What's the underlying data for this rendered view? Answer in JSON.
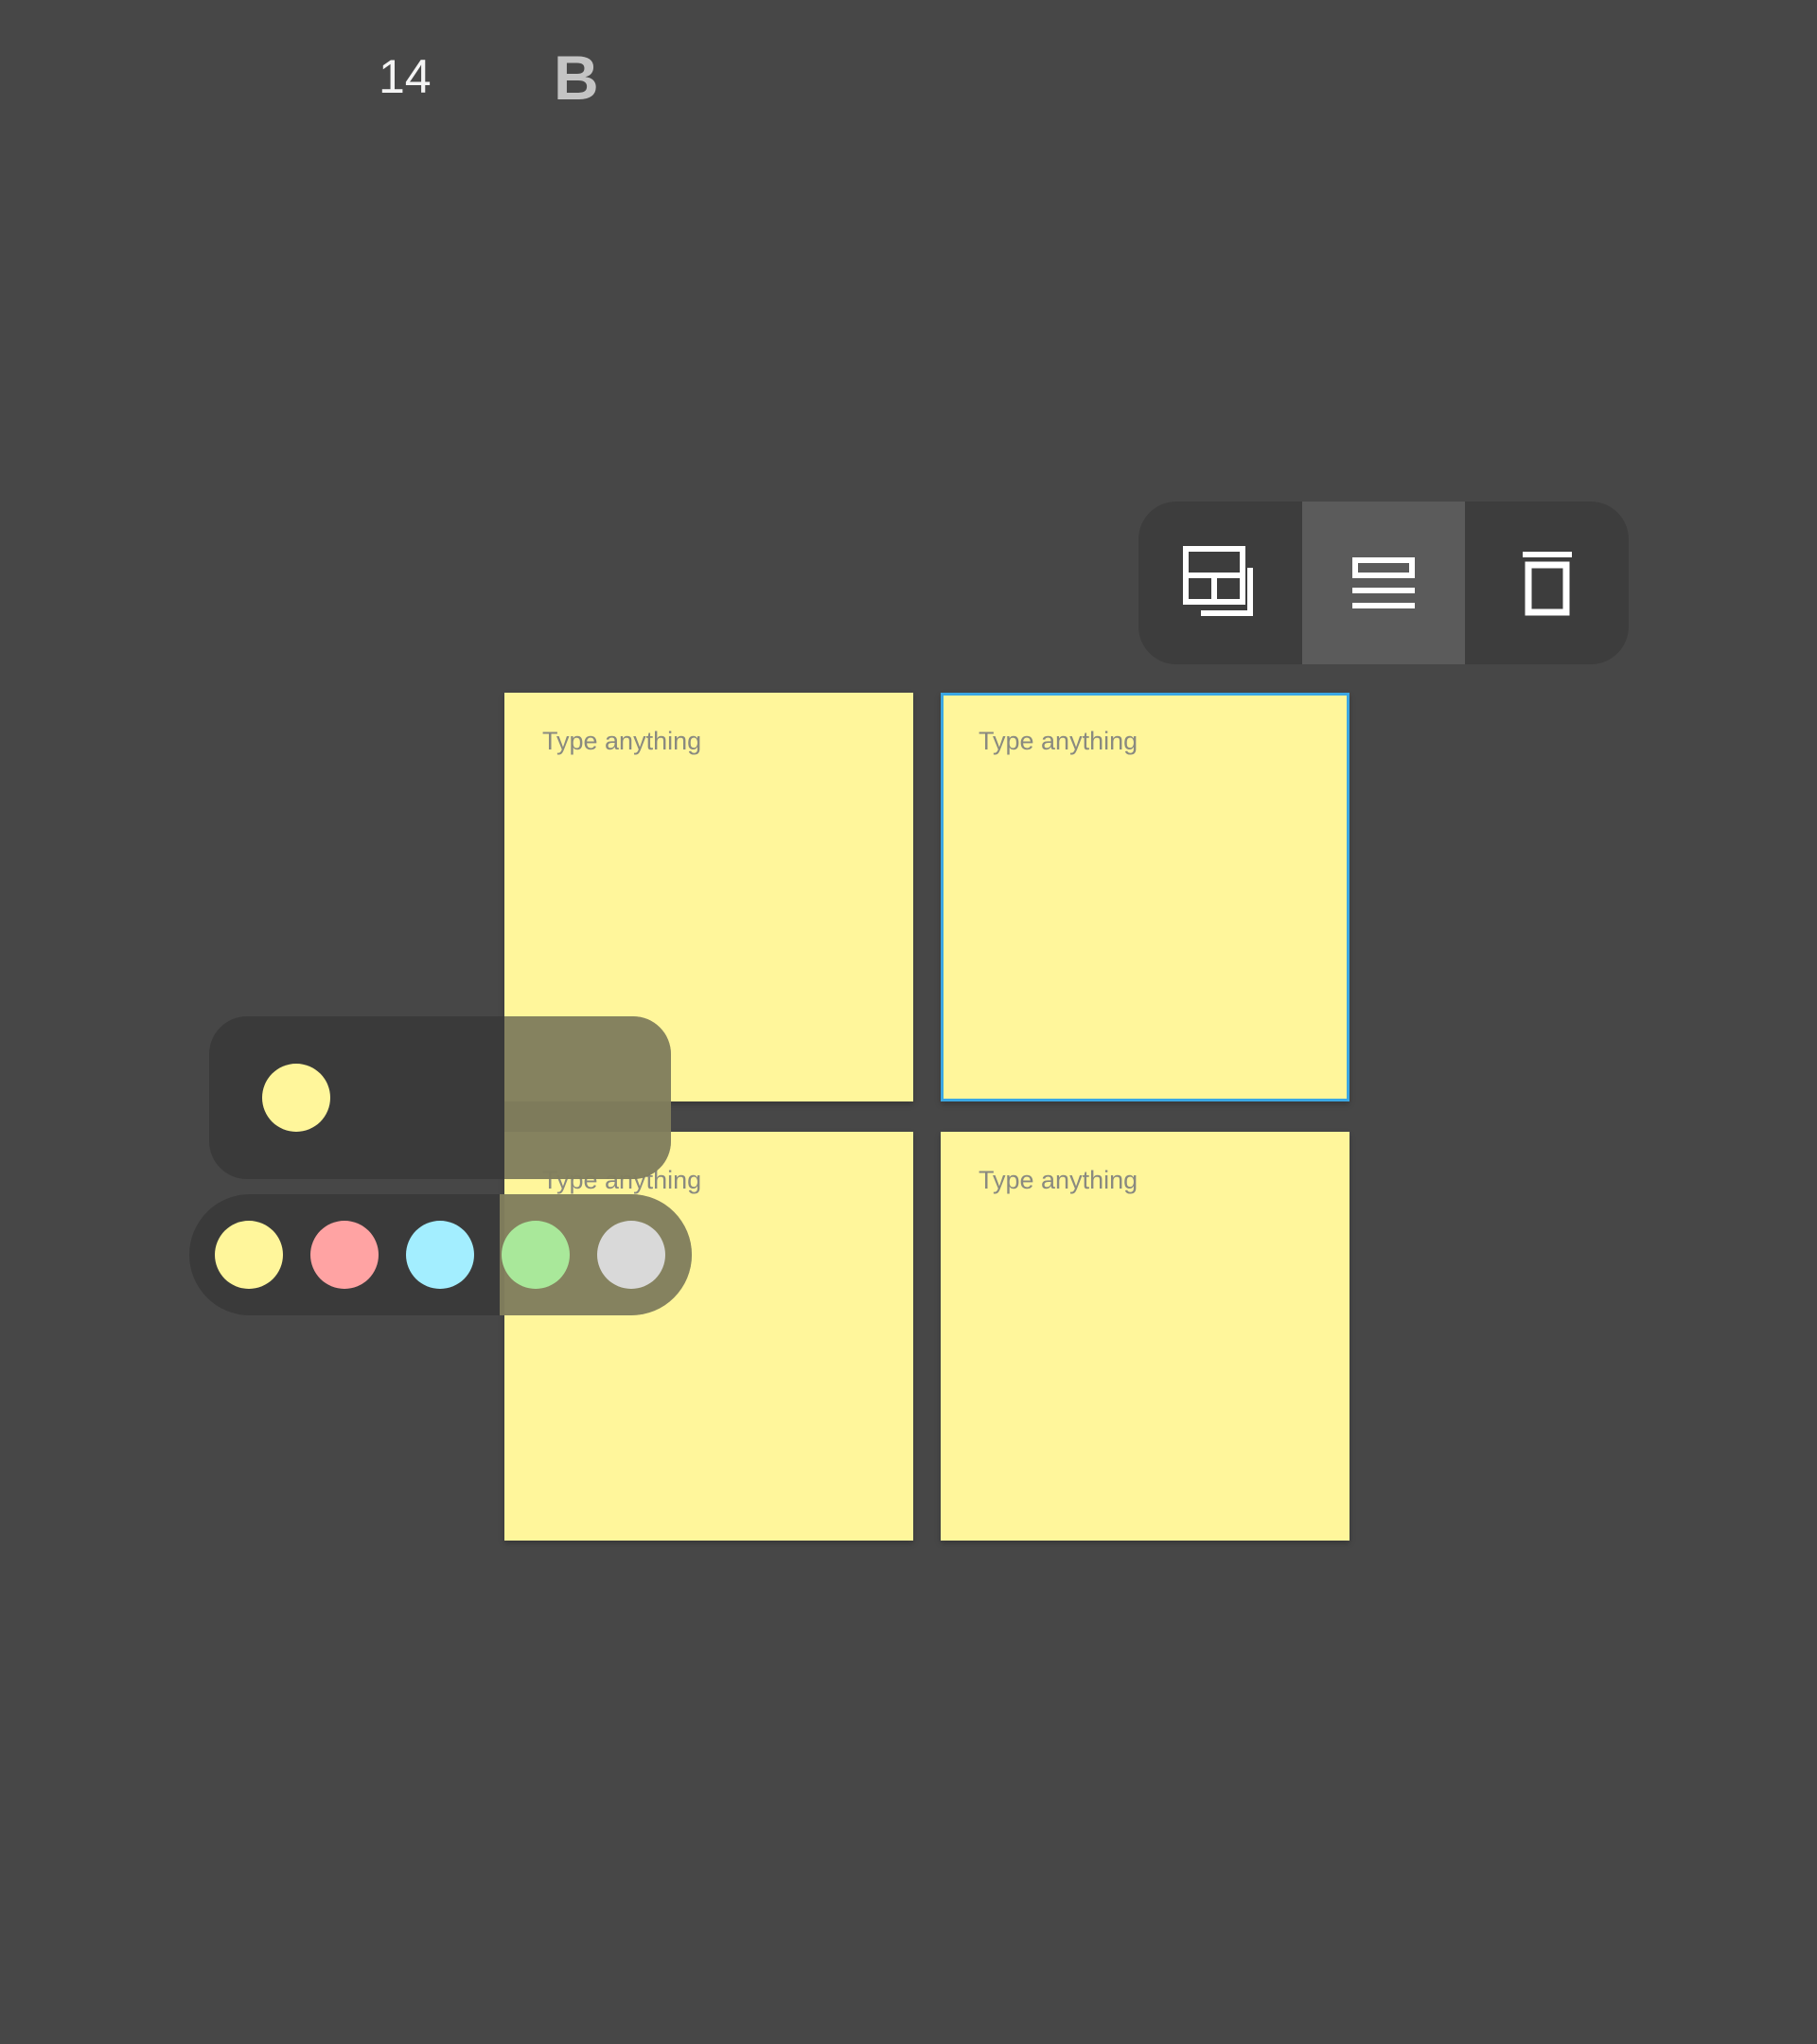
{
  "toolbar": {
    "buttons": [
      {
        "icon": "layout-grid-icon",
        "active": false
      },
      {
        "icon": "text-lines-icon",
        "active": true
      },
      {
        "icon": "trash-icon",
        "active": false
      }
    ]
  },
  "notes": [
    {
      "placeholder": "Type anything",
      "selected": false
    },
    {
      "placeholder": "Type anything",
      "selected": true
    },
    {
      "placeholder": "Type anything",
      "selected": false
    },
    {
      "placeholder": "Type anything",
      "selected": false
    }
  ],
  "format": {
    "current_color": "#fff69b",
    "font_size": "14",
    "bold_label": "B"
  },
  "palette": {
    "colors": [
      "#fff69b",
      "#ffa3a3",
      "#a3eeff",
      "#a9e89a",
      "#d9d9d9"
    ]
  },
  "colors": {
    "background": "#474747",
    "note": "#fff69b",
    "selection_border": "#3ba7e3"
  }
}
